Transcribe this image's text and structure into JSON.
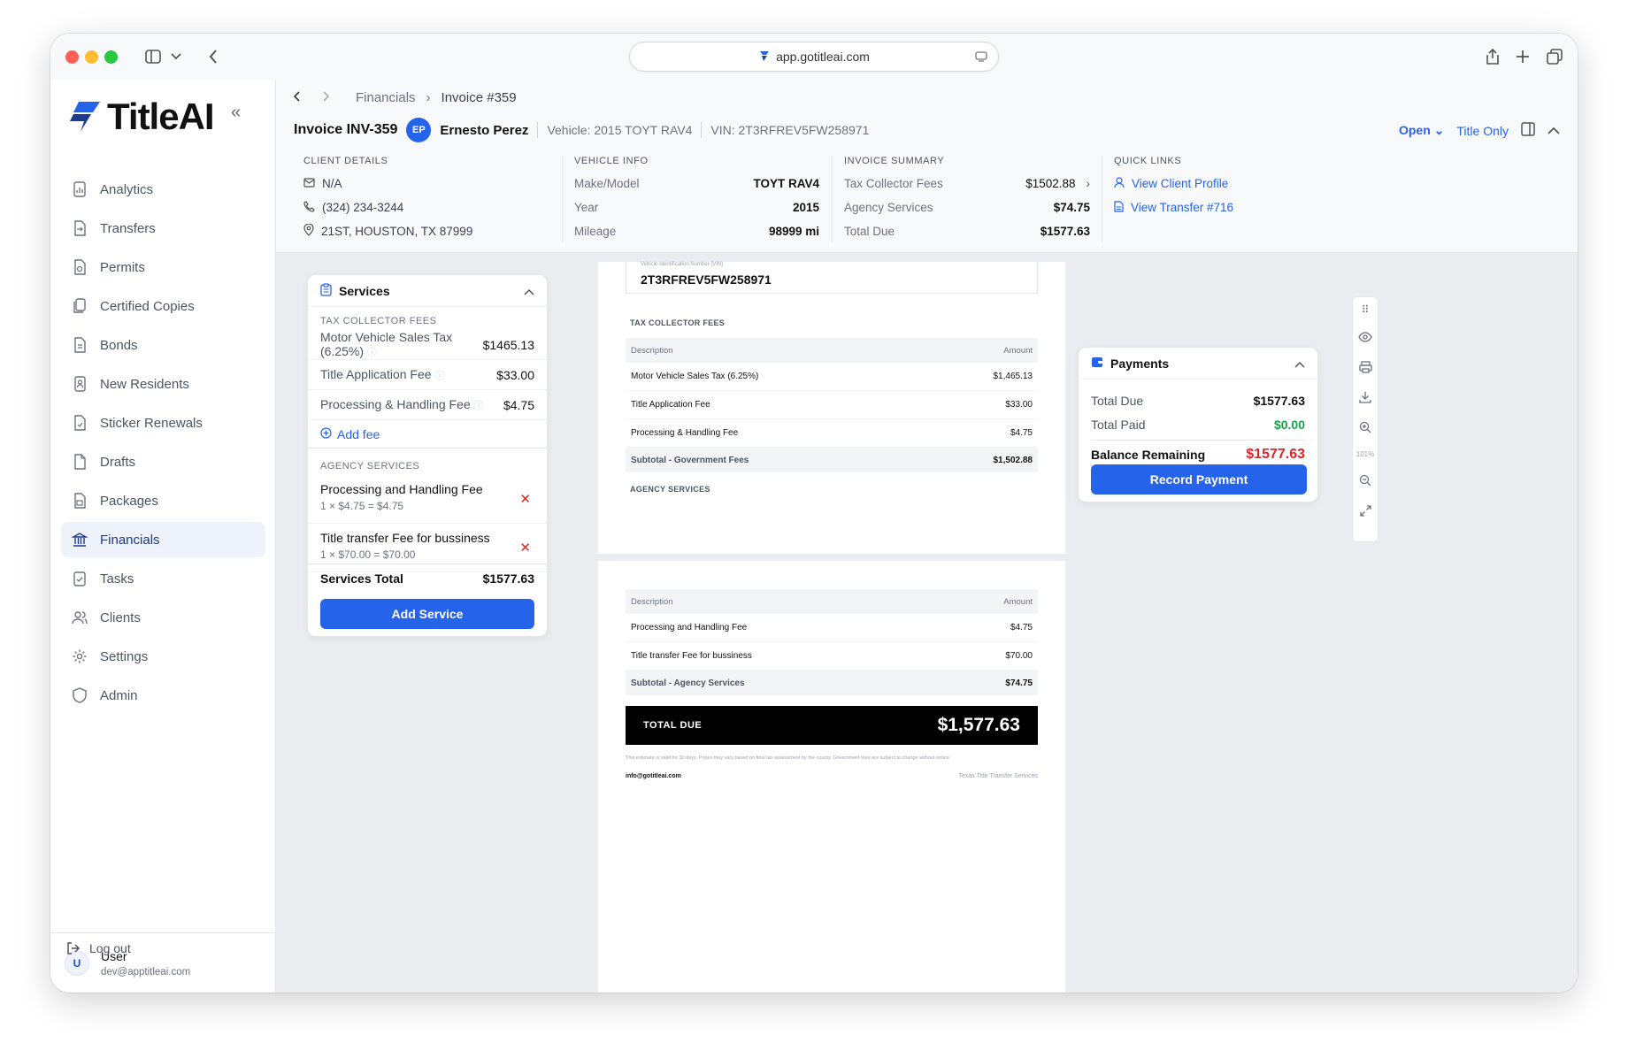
{
  "browser": {
    "url": "app.gotitleai.com"
  },
  "brand": {
    "name": "TitleAI"
  },
  "sidebar": {
    "items": [
      {
        "label": "Analytics",
        "icon": "analytics-icon"
      },
      {
        "label": "Transfers",
        "icon": "transfers-icon"
      },
      {
        "label": "Permits",
        "icon": "permits-icon"
      },
      {
        "label": "Certified Copies",
        "icon": "copies-icon"
      },
      {
        "label": "Bonds",
        "icon": "bonds-icon"
      },
      {
        "label": "New Residents",
        "icon": "residents-icon"
      },
      {
        "label": "Sticker Renewals",
        "icon": "sticker-icon"
      },
      {
        "label": "Drafts",
        "icon": "drafts-icon"
      },
      {
        "label": "Packages",
        "icon": "packages-icon"
      },
      {
        "label": "Financials",
        "icon": "bank-icon",
        "active": true
      },
      {
        "label": "Tasks",
        "icon": "tasks-icon"
      },
      {
        "label": "Clients",
        "icon": "clients-icon"
      },
      {
        "label": "Settings",
        "icon": "gear-icon"
      },
      {
        "label": "Admin",
        "icon": "shield-icon"
      }
    ],
    "user": {
      "initial": "U",
      "name": "User",
      "email": "dev@apptitleai.com"
    },
    "logout": "Log out"
  },
  "breadcrumb": {
    "parent": "Financials",
    "current": "Invoice #359"
  },
  "invoice": {
    "title": "Invoice INV-359",
    "client_initials": "EP",
    "client_name": "Ernesto Perez",
    "vehicle": "Vehicle: 2015 TOYT RAV4",
    "vin": "VIN: 2T3RFREV5FW258971",
    "status": "Open",
    "type": "Title Only"
  },
  "client_details": {
    "header": "CLIENT DETAILS",
    "email": "N/A",
    "phone": "(324) 234-3244",
    "address": "21ST, HOUSTON, TX 87999"
  },
  "vehicle_info": {
    "header": "VEHICLE INFO",
    "rows": [
      {
        "label": "Make/Model",
        "value": "TOYT RAV4"
      },
      {
        "label": "Year",
        "value": "2015"
      },
      {
        "label": "Mileage",
        "value": "98999 mi"
      }
    ]
  },
  "invoice_summary": {
    "header": "INVOICE SUMMARY",
    "rows": [
      {
        "label": "Tax Collector Fees",
        "value": "$1502.88"
      },
      {
        "label": "Agency Services",
        "value": "$74.75"
      },
      {
        "label": "Total Due",
        "value": "$1577.63"
      }
    ]
  },
  "quick_links": {
    "header": "QUICK LINKS",
    "client": "View Client Profile",
    "transfer": "View Transfer #716"
  },
  "services": {
    "title": "Services",
    "tax_header": "TAX COLLECTOR FEES",
    "tax_items": [
      {
        "label": "Motor Vehicle Sales Tax (6.25%)",
        "amount": "$1465.13"
      },
      {
        "label": "Title Application Fee",
        "amount": "$33.00"
      },
      {
        "label": "Processing & Handling Fee",
        "amount": "$4.75"
      }
    ],
    "add_fee": "Add fee",
    "agency_header": "AGENCY SERVICES",
    "agency_items": [
      {
        "name": "Processing and Handling Fee",
        "detail": "1 × $4.75 = $4.75"
      },
      {
        "name": "Title transfer Fee for bussiness",
        "detail": "1 × $70.00 = $70.00"
      }
    ],
    "total_label": "Services Total",
    "total_value": "$1577.63",
    "add_button": "Add Service"
  },
  "document": {
    "vin_label": "Vehicle Identification Number (VIN)",
    "vin": "2T3RFREV5FW258971",
    "tax_title": "TAX COLLECTOR FEES",
    "col_desc": "Description",
    "col_amount": "Amount",
    "tax_rows": [
      {
        "desc": "Motor Vehicle Sales Tax (6.25%)",
        "amount": "$1,465.13"
      },
      {
        "desc": "Title Application Fee",
        "amount": "$33.00"
      },
      {
        "desc": "Processing & Handling Fee",
        "amount": "$4.75"
      }
    ],
    "tax_subtotal_label": "Subtotal - Government Fees",
    "tax_subtotal": "$1,502.88",
    "agency_title": "AGENCY SERVICES",
    "agency_rows": [
      {
        "desc": "Processing and Handling Fee",
        "amount": "$4.75"
      },
      {
        "desc": "Title transfer Fee for bussiness",
        "amount": "$70.00"
      }
    ],
    "agency_subtotal_label": "Subtotal - Agency Services",
    "agency_subtotal": "$74.75",
    "total_label": "TOTAL DUE",
    "total_value": "$1,577.63",
    "disclaimer": "This estimate is valid for 30 days. Prices may vary based on final tax assessment by the county. Government fees are subject to change without notice.",
    "email": "info@gotitleai.com",
    "company": "Texas Title Transfer Services"
  },
  "viewer": {
    "zoom": "101%"
  },
  "payments": {
    "title": "Payments",
    "total_due_label": "Total Due",
    "total_due": "$1577.63",
    "total_paid_label": "Total Paid",
    "total_paid": "$0.00",
    "balance_label": "Balance Remaining",
    "balance": "$1577.63",
    "button": "Record Payment"
  },
  "colors": {
    "accent": "#2563eb",
    "danger": "#dc2626",
    "success": "#16a34a"
  }
}
